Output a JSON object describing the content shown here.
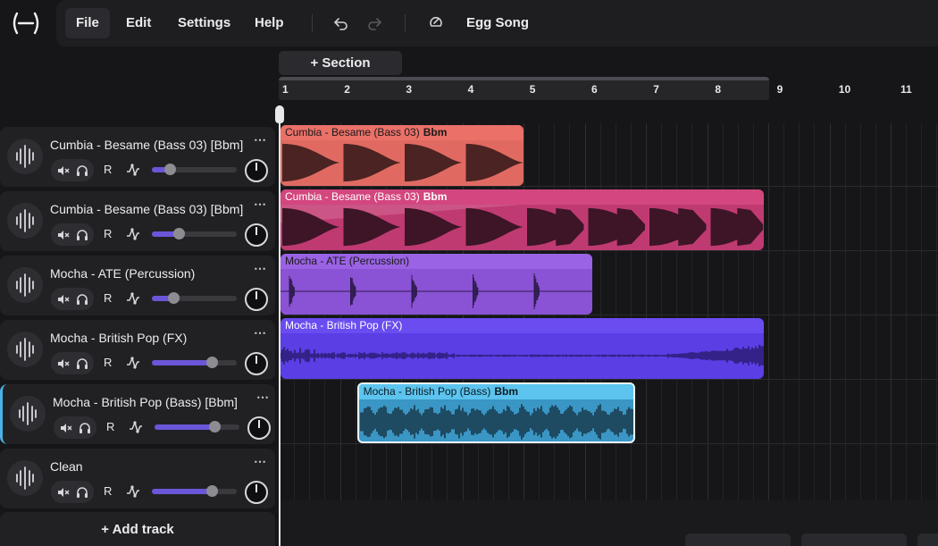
{
  "header": {
    "menu": [
      {
        "id": "file",
        "label": "File"
      },
      {
        "id": "edit",
        "label": "Edit"
      },
      {
        "id": "settings",
        "label": "Settings"
      },
      {
        "id": "help",
        "label": "Help"
      }
    ],
    "song_title": "Egg Song",
    "icons": [
      "logo-icon",
      "undo-icon",
      "redo-icon",
      "metronome-icon"
    ]
  },
  "timeline": {
    "section_button": "Section",
    "bars": [
      "1",
      "2",
      "3",
      "4",
      "5",
      "6",
      "7",
      "8",
      "9",
      "10",
      "11"
    ]
  },
  "tracks": [
    {
      "name": "Cumbia - Besame (Bass 03) [Bbm]",
      "record": "R",
      "volume": 0.21,
      "selected": false
    },
    {
      "name": "Cumbia - Besame (Bass 03) [Bbm]",
      "record": "R",
      "volume": 0.32,
      "selected": false
    },
    {
      "name": "Mocha - ATE (Percussion)",
      "record": "R",
      "volume": 0.25,
      "selected": false
    },
    {
      "name": "Mocha - British Pop (FX)",
      "record": "R",
      "volume": 0.7,
      "selected": false
    },
    {
      "name": "Mocha - British Pop (Bass) [Bbm]",
      "record": "R",
      "volume": 0.7,
      "selected": true
    },
    {
      "name": "Clean",
      "record": "R",
      "volume": 0.7,
      "selected": false
    }
  ],
  "add_track": "Add track",
  "clips": [
    {
      "track": 0,
      "name": "Cumbia - Besame (Bass 03)",
      "key": "Bbm",
      "start_bar": 1,
      "end_bar": 4.97,
      "color": "#e06a62",
      "header_color": "#ea7068",
      "text_color": "#1a1a1a",
      "wave": "bass",
      "wave_color": "#4a2322"
    },
    {
      "track": 1,
      "name": "Cumbia - Besame (Bass 03)",
      "key": "Bbm",
      "start_bar": 1,
      "end_bar": 8.9,
      "color": "#c03a72",
      "header_color": "#d3467e",
      "text_color": "#ffffff",
      "wave": "bass2",
      "wave_color": "#3d1526"
    },
    {
      "track": 2,
      "name": "Mocha - ATE (Percussion)",
      "key": "",
      "start_bar": 1,
      "end_bar": 6.1,
      "color": "#8a52d4",
      "header_color": "#9a62e4",
      "text_color": "#1a1a1a",
      "wave": "perc",
      "wave_color": "#2e1c4e"
    },
    {
      "track": 3,
      "name": "Mocha - British Pop (FX)",
      "key": "",
      "start_bar": 1,
      "end_bar": 8.9,
      "color": "#5b3ee4",
      "header_color": "#6a4cf0",
      "text_color": "#ffffff",
      "wave": "fx",
      "wave_color": "#241660"
    },
    {
      "track": 4,
      "name": "Mocha - British Pop (Bass)",
      "key": "Bbm",
      "start_bar": 2.25,
      "end_bar": 6.8,
      "color": "#3a96c4",
      "header_color": "#5cc4ee",
      "text_color": "#0c1a22",
      "wave": "dense",
      "wave_color": "#17384a"
    }
  ],
  "colors": {
    "selected_track": "#4ab2e8",
    "volume_fill": "#6a56d8"
  }
}
